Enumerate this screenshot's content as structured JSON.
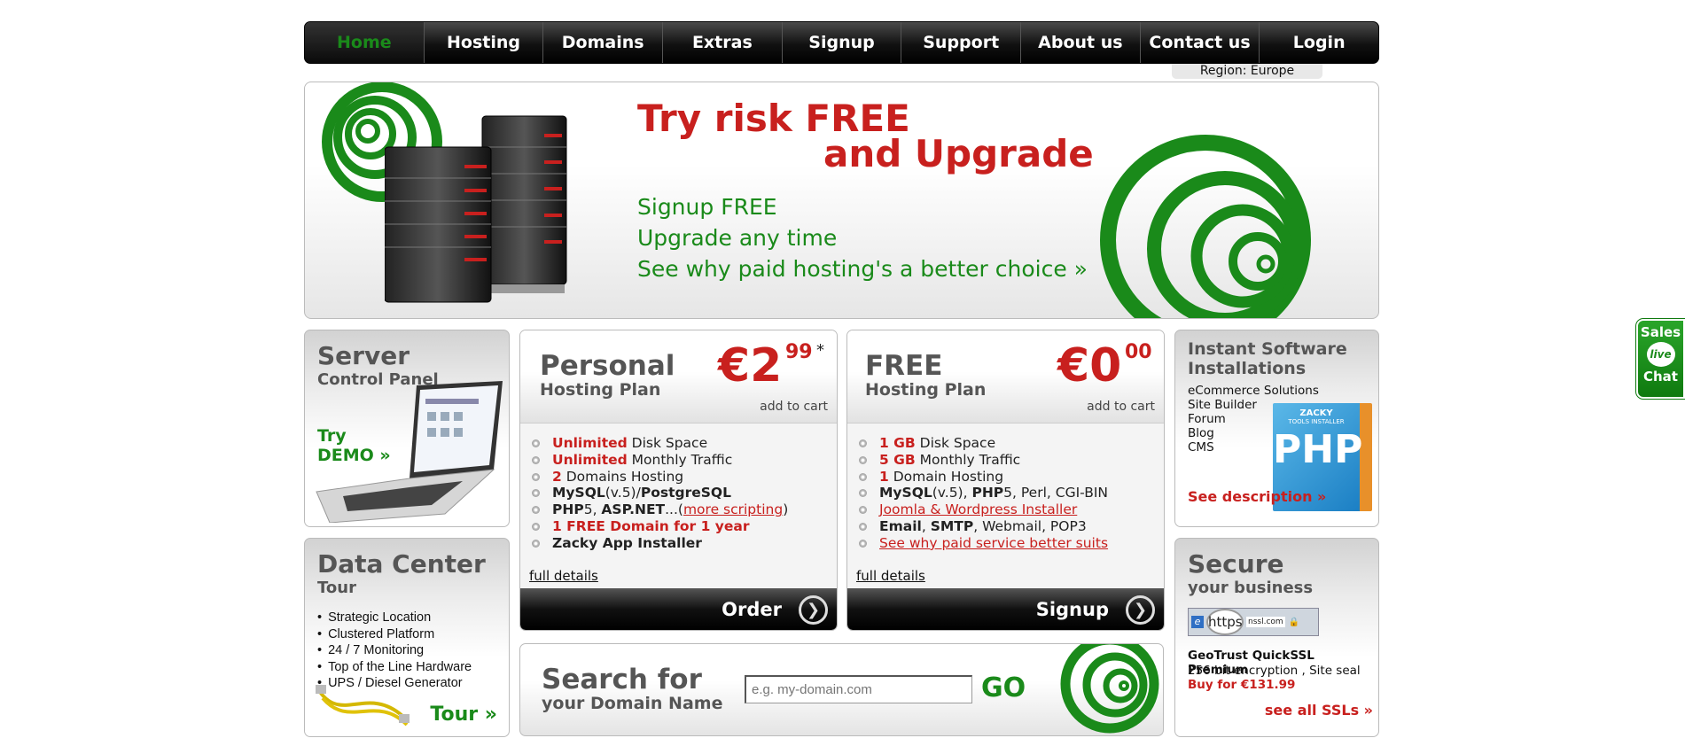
{
  "nav": {
    "items": [
      "Home",
      "Hosting",
      "Domains",
      "Extras",
      "Signup",
      "Support",
      "About us",
      "Contact us",
      "Login"
    ],
    "active_index": 0
  },
  "region": "Region: Europe",
  "hero": {
    "title_line1": "Try risk FREE",
    "title_line2": "and Upgrade",
    "line1": "Signup FREE",
    "line2": "Upgrade any time",
    "line3": "See why paid hosting's a better choice »"
  },
  "server_box": {
    "title": "Server",
    "subtitle": "Control Panel",
    "try_line1": "Try",
    "try_line2": "DEMO »"
  },
  "datacenter_box": {
    "title": "Data Center",
    "subtitle": "Tour",
    "items": [
      "Strategic Location",
      "Clustered Platform",
      "24 / 7 Monitoring",
      "Top of the Line Hardware",
      "UPS / Diesel Generator"
    ],
    "tour_link": "Tour »"
  },
  "personal_plan": {
    "name": "Personal",
    "sub": "Hosting Plan",
    "price": "€2",
    "cents": "99",
    "asterisk": "*",
    "add_to_cart": "add to cart",
    "features": [
      {
        "hl": "Unlimited",
        "text": " Disk Space"
      },
      {
        "hl": "Unlimited",
        "text": " Monthly Traffic"
      },
      {
        "hl": "2",
        "text": " Domains Hosting"
      },
      {
        "b1": "MySQL",
        "t1": "(v.5)/",
        "b2": "PostgreSQL"
      },
      {
        "b1": "PHP",
        "t1": "5, ",
        "b2": "ASP.NET",
        "t2": "...(",
        "link": "more scripting",
        "t3": ")"
      },
      {
        "hl": "1 FREE Domain for 1 year"
      },
      {
        "bold": "Zacky App Installer"
      }
    ],
    "full_details": "full details",
    "button": "Order"
  },
  "free_plan": {
    "name": "FREE",
    "sub": "Hosting Plan",
    "price": "€0",
    "cents": "00",
    "add_to_cart": "add to cart",
    "features": [
      {
        "hl": "1 GB",
        "text": " Disk Space"
      },
      {
        "hl": "5 GB",
        "text": " Monthly Traffic"
      },
      {
        "hl": "1",
        "text": " Domain Hosting"
      },
      {
        "b1": "MySQL",
        "t1": "(v.5), ",
        "b2": "PHP",
        "t2": "5, Perl, CGI-BIN"
      },
      {
        "link": "Joomla & Wordpress Installer"
      },
      {
        "b1": "Email",
        "t1": ", ",
        "b2": "SMTP",
        "t2": ", Webmail, POP3"
      },
      {
        "link": "See why paid service better suits"
      }
    ],
    "full_details": "full details",
    "button": "Signup"
  },
  "search": {
    "title": "Search for",
    "subtitle": "your Domain Name",
    "placeholder": "e.g. my-domain.com",
    "go": "GO"
  },
  "software_box": {
    "title": "Instant Software Installations",
    "items": [
      "eCommerce Solutions",
      "Site Builder",
      "Forum",
      "Blog",
      "CMS"
    ],
    "link": "See description »",
    "badge_top": "ZACKY",
    "badge_mid": "TOOLS INSTALLER",
    "badge_php": "PHP"
  },
  "secure_box": {
    "title": "Secure",
    "subtitle": "your business",
    "https_text": "https",
    "url_stub": "nssl.com",
    "product": "GeoTrust QuickSSL Premium",
    "desc": "256 bit encryption , Site seal",
    "buy": "Buy for €131.99",
    "link": "see all SSLs »"
  },
  "chat": {
    "top": "Sales",
    "bubble": "live",
    "bottom": "Chat"
  },
  "colors": {
    "brand_red": "#c8201e",
    "brand_green": "#1a8a1a",
    "nav_bg": "#111111"
  }
}
